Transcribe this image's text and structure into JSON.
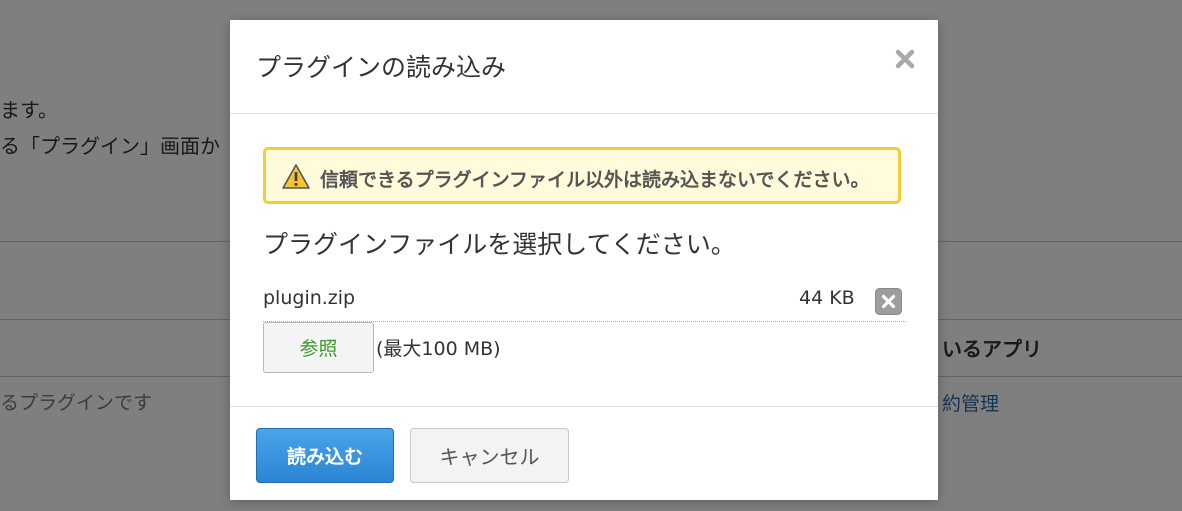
{
  "background": {
    "line1": "ます。",
    "line2": "る「プラグイン」画面か",
    "column_header": "いるアプリ",
    "row_left": "るプラグインです",
    "row_right": "約管理"
  },
  "dialog": {
    "title": "プラグインの読み込み",
    "close_icon": "close-icon",
    "warning": {
      "icon": "warning-triangle-icon",
      "text": "信頼できるプラグインファイル以外は読み込まないでください。",
      "bg_color": "#fffbdb",
      "border_color": "#f2cd3a"
    },
    "select_label": "プラグインファイルを選択してください。",
    "file": {
      "name": "plugin.zip",
      "size": "44 KB",
      "remove_icon": "remove-file-icon"
    },
    "browse_label": "参照",
    "max_size": "(最大100 MB)",
    "footer": {
      "load_label": "読み込む",
      "cancel_label": "キャンセル",
      "load_color": "#2b85d3"
    }
  }
}
